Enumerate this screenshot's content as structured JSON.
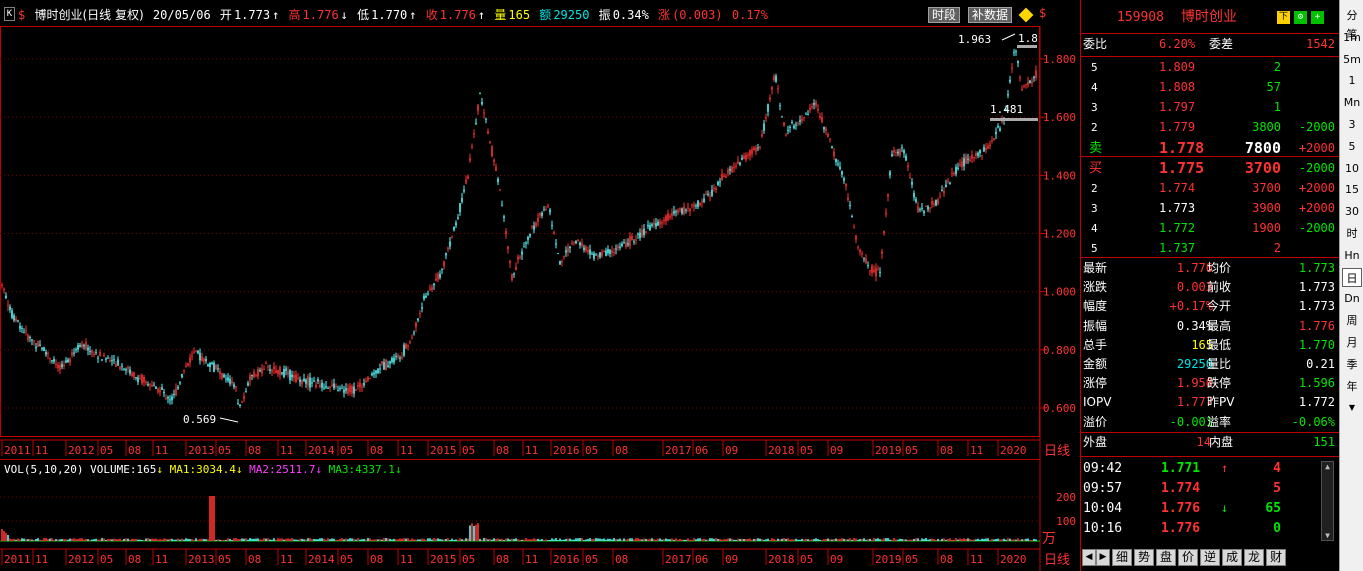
{
  "header": {
    "k_label": "K",
    "s_icon": "$",
    "name": "博时创业(日线 复权)",
    "date": "20/05/06",
    "open_label": "开",
    "open": "1.773",
    "high_label": "高",
    "high": "1.776",
    "low_label": "低",
    "low": "1.770",
    "close_label": "收",
    "close": "1.776",
    "vol_label": "量",
    "vol": "165",
    "amt_label": "额",
    "amt": "29250",
    "amp_label": "振",
    "amp": "0.34%",
    "chg_label": "涨",
    "chg": "(0.003)",
    "chg_pct": "0.17%",
    "btn_timeshare": "时段",
    "btn_fill": "补数据"
  },
  "price_axis": [
    "1.800",
    "1.600",
    "1.400",
    "1.200",
    "1.000",
    "0.800",
    "0.600"
  ],
  "annotations": {
    "max_label": "1.963",
    "max_right": "1.8",
    "min_label": "0.569",
    "mid_label": "1.481"
  },
  "date_axis": [
    "2011",
    "11",
    "2012",
    "05",
    "08",
    "11",
    "2013",
    "05",
    "08",
    "11",
    "2014",
    "05",
    "08",
    "11",
    "2015",
    "05",
    "08",
    "11",
    "2016",
    "05",
    "08",
    "2017",
    "06",
    "09",
    "2018",
    "05",
    "09",
    "2019",
    "05",
    "08",
    "11",
    "2020"
  ],
  "period_label": "日线",
  "vol": {
    "title": "VOL(5,10,20)",
    "volume_label": "VOLUME:",
    "volume": "165",
    "ma1_label": "MA1:",
    "ma1": "3034.4",
    "ma2_label": "MA2:",
    "ma2": "2511.7",
    "ma3_label": "MA3:",
    "ma3": "4337.1",
    "axis": [
      "200",
      "100"
    ],
    "unit": "万"
  },
  "quote": {
    "code": "159908",
    "name": "博时创业",
    "weibi_label": "委比",
    "weibi": "6.20%",
    "weicha_label": "委差",
    "weicha": "1542",
    "sell": [
      {
        "lvl": "5",
        "price": "1.809",
        "vol": "2",
        "chg": ""
      },
      {
        "lvl": "4",
        "price": "1.808",
        "vol": "57",
        "chg": ""
      },
      {
        "lvl": "3",
        "price": "1.797",
        "vol": "1",
        "chg": ""
      },
      {
        "lvl": "2",
        "price": "1.779",
        "vol": "3800",
        "chg": "-2000"
      },
      {
        "lvl": "卖",
        "price": "1.778",
        "vol": "7800",
        "chg": "+2000"
      }
    ],
    "buy": [
      {
        "lvl": "买",
        "price": "1.775",
        "vol": "3700",
        "chg": "-2000"
      },
      {
        "lvl": "2",
        "price": "1.774",
        "vol": "3700",
        "chg": "+2000"
      },
      {
        "lvl": "3",
        "price": "1.773",
        "vol": "3900",
        "chg": "+2000"
      },
      {
        "lvl": "4",
        "price": "1.772",
        "vol": "1900",
        "chg": "-2000"
      },
      {
        "lvl": "5",
        "price": "1.737",
        "vol": "2",
        "chg": ""
      }
    ],
    "stats": [
      {
        "l1": "最新",
        "v1": "1.776",
        "l2": "均价",
        "v2": "1.773"
      },
      {
        "l1": "涨跌",
        "v1": "0.003",
        "l2": "前收",
        "v2": "1.773"
      },
      {
        "l1": "幅度",
        "v1": "+0.17%",
        "l2": "今开",
        "v2": "1.773"
      },
      {
        "l1": "振幅",
        "v1": "0.34%",
        "l2": "最高",
        "v2": "1.776"
      },
      {
        "l1": "总手",
        "v1": "165",
        "l2": "最低",
        "v2": "1.770"
      },
      {
        "l1": "金额",
        "v1": "29250",
        "l2": "量比",
        "v2": "0.21"
      },
      {
        "l1": "涨停",
        "v1": "1.950",
        "l2": "跌停",
        "v2": "1.596"
      },
      {
        "l1": "IOPV",
        "v1": "1.777",
        "l2": "昨PV",
        "v2": "1.772"
      },
      {
        "l1": "溢价",
        "v1": "-0.001",
        "l2": "溢率",
        "v2": "-0.06%"
      }
    ],
    "outer_label": "外盘",
    "outer": "14",
    "inner_label": "内盘",
    "inner": "151",
    "ticks": [
      {
        "time": "09:42",
        "price": "1.771",
        "arrow": "↑",
        "vol": "4"
      },
      {
        "time": "09:57",
        "price": "1.774",
        "arrow": "",
        "vol": "5"
      },
      {
        "time": "10:04",
        "price": "1.776",
        "arrow": "↓",
        "vol": "65"
      },
      {
        "time": "10:16",
        "price": "1.776",
        "arrow": "",
        "vol": "0"
      }
    ]
  },
  "tabs": [
    "细",
    "势",
    "盘",
    "价",
    "逆",
    "成",
    "龙",
    "财"
  ],
  "periods": [
    "分笔",
    "1m",
    "5m",
    "1",
    "Mn",
    "3",
    "5",
    "10",
    "15",
    "30",
    "时",
    "Hn",
    "日",
    "Dn",
    "周",
    "月",
    "季",
    "年"
  ],
  "colors": {
    "up": "#ff3232",
    "down": "#54ffff",
    "grid": "#800000",
    "axis": "#c00000"
  }
}
